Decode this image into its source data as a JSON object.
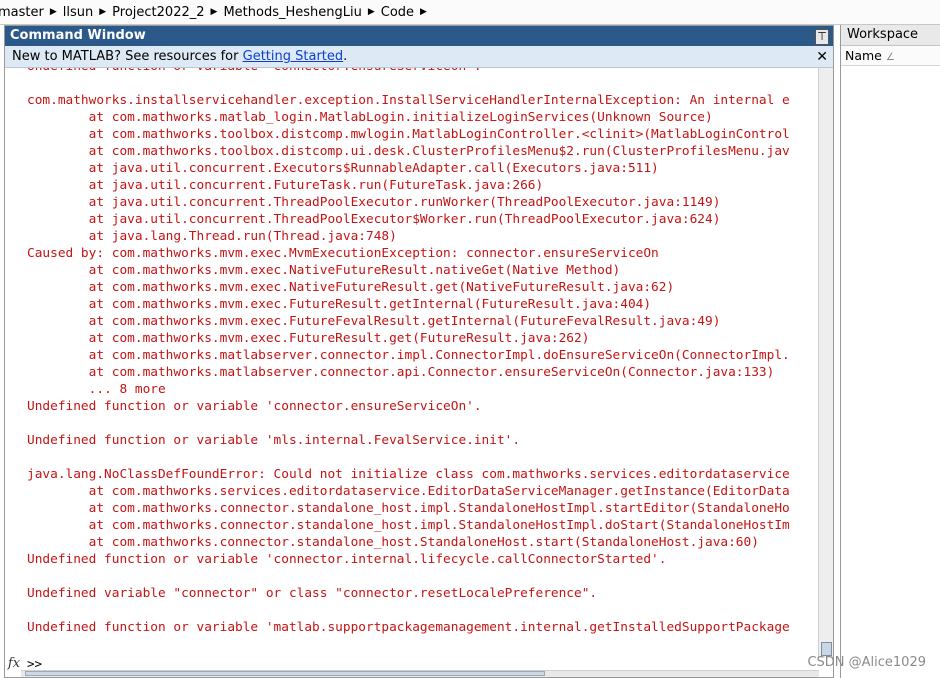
{
  "breadcrumb": [
    "master",
    "llsun",
    "Project2022_2",
    "Methods_HeshengLiu",
    "Code"
  ],
  "command_window": {
    "title": "Command Window",
    "undock_glyph": "⊤",
    "info_text": "New to MATLAB? See resources for ",
    "info_link": "Getting Started",
    "info_suffix": ".",
    "close_glyph": "✕",
    "prompt": ">>",
    "fx_label": "fx"
  },
  "output_lines": [
    "Undefined function or variable 'connector.ensureServiceOn'.",
    "",
    "com.mathworks.installservicehandler.exception.InstallServiceHandlerInternalException: An internal e",
    "        at com.mathworks.matlab_login.MatlabLogin.initializeLoginServices(Unknown Source)",
    "        at com.mathworks.toolbox.distcomp.mwlogin.MatlabLoginController.<clinit>(MatlabLoginControl",
    "        at com.mathworks.toolbox.distcomp.ui.desk.ClusterProfilesMenu$2.run(ClusterProfilesMenu.jav",
    "        at java.util.concurrent.Executors$RunnableAdapter.call(Executors.java:511)",
    "        at java.util.concurrent.FutureTask.run(FutureTask.java:266)",
    "        at java.util.concurrent.ThreadPoolExecutor.runWorker(ThreadPoolExecutor.java:1149)",
    "        at java.util.concurrent.ThreadPoolExecutor$Worker.run(ThreadPoolExecutor.java:624)",
    "        at java.lang.Thread.run(Thread.java:748)",
    "Caused by: com.mathworks.mvm.exec.MvmExecutionException: connector.ensureServiceOn",
    "        at com.mathworks.mvm.exec.NativeFutureResult.nativeGet(Native Method)",
    "        at com.mathworks.mvm.exec.NativeFutureResult.get(NativeFutureResult.java:62)",
    "        at com.mathworks.mvm.exec.FutureResult.getInternal(FutureResult.java:404)",
    "        at com.mathworks.mvm.exec.FutureFevalResult.getInternal(FutureFevalResult.java:49)",
    "        at com.mathworks.mvm.exec.FutureResult.get(FutureResult.java:262)",
    "        at com.mathworks.matlabserver.connector.impl.ConnectorImpl.doEnsureServiceOn(ConnectorImpl.",
    "        at com.mathworks.matlabserver.connector.api.Connector.ensureServiceOn(Connector.java:133)",
    "        ... 8 more",
    "Undefined function or variable 'connector.ensureServiceOn'.",
    "",
    "Undefined function or variable 'mls.internal.FevalService.init'.",
    "",
    "java.lang.NoClassDefFoundError: Could not initialize class com.mathworks.services.editordataservice",
    "        at com.mathworks.services.editordataservice.EditorDataServiceManager.getInstance(EditorData",
    "        at com.mathworks.connector.standalone_host.impl.StandaloneHostImpl.startEditor(StandaloneHo",
    "        at com.mathworks.connector.standalone_host.impl.StandaloneHostImpl.doStart(StandaloneHostIm",
    "        at com.mathworks.connector.standalone_host.StandaloneHost.start(StandaloneHost.java:60)",
    "Undefined function or variable 'connector.internal.lifecycle.callConnectorStarted'.",
    "",
    "Undefined variable \"connector\" or class \"connector.resetLocalePreference\".",
    "",
    "Undefined function or variable 'matlab.supportpackagemanagement.internal.getInstalledSupportPackage"
  ],
  "workspace": {
    "title": "Workspace",
    "column_name": "Name",
    "sort_glyph": "∠"
  },
  "watermark": "CSDN @Alice1029",
  "colors": {
    "error_text": "#c41414",
    "title_bar": "#2b5a8a",
    "info_bar": "#ddeaf6",
    "link": "#0b3fd1"
  }
}
